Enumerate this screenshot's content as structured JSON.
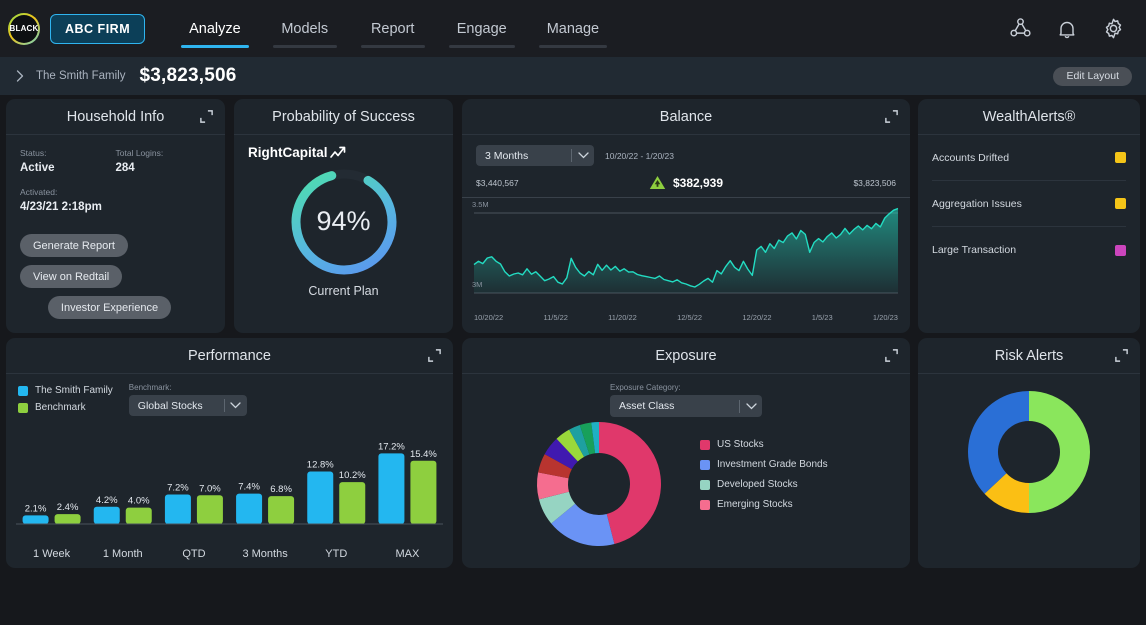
{
  "nav": {
    "logo_text": "BLACK",
    "firm_name": "ABC FIRM",
    "tabs": [
      {
        "label": "Analyze",
        "active": true
      },
      {
        "label": "Models",
        "active": false
      },
      {
        "label": "Report",
        "active": false
      },
      {
        "label": "Engage",
        "active": false
      },
      {
        "label": "Manage",
        "active": false
      }
    ],
    "icons": [
      "share-network-icon",
      "bell-icon",
      "gear-icon"
    ]
  },
  "clientbar": {
    "expand_icon": "chevron-right-icon",
    "client_name": "The Smith Family",
    "total_value": "$3,823,506",
    "edit_layout_label": "Edit Layout"
  },
  "household": {
    "title": "Household Info",
    "status_label": "Status:",
    "status_value": "Active",
    "logins_label": "Total Logins:",
    "logins_value": "284",
    "activated_label": "Activated:",
    "activated_value": "4/23/21 2:18pm",
    "btn_generate": "Generate Report",
    "btn_redtail": "View on Redtail",
    "btn_investor": "Investor Experience"
  },
  "probability": {
    "title": "Probability of Success",
    "brand": "RightCapital",
    "value": "94%",
    "caption": "Current Plan",
    "percent": 94,
    "gradient_start": "#4fd9b4",
    "gradient_end": "#5a97ee"
  },
  "balance": {
    "title": "Balance",
    "period_selected": "3 Months",
    "date_range": "10/20/22 - 1/20/23",
    "start_value": "$3,440,567",
    "change_value": "$382,939",
    "change_direction": "up",
    "end_value": "$3,823,506",
    "line_color": "#23dcc2",
    "chart_data": {
      "type": "area",
      "title": "Balance",
      "xlabel": "",
      "ylabel": "",
      "ylim": [
        3000000,
        3900000
      ],
      "ytick_labels": [
        "3.5M",
        "3M"
      ],
      "xtick_labels": [
        "10/20/22",
        "11/5/22",
        "11/20/22",
        "12/5/22",
        "12/20/22",
        "1/5/23",
        "1/20/23"
      ],
      "grid": false,
      "series": [
        {
          "name": "Balance",
          "values": [
            3448000,
            3470000,
            3455000,
            3492000,
            3500000,
            3470000,
            3452000,
            3400000,
            3372000,
            3385000,
            3392000,
            3380000,
            3420000,
            3384000,
            3400000,
            3370000,
            3340000,
            3352000,
            3368000,
            3330000,
            3318000,
            3360000,
            3490000,
            3430000,
            3392000,
            3372000,
            3402000,
            3380000,
            3450000,
            3410000,
            3444000,
            3412000,
            3436000,
            3404000,
            3420000,
            3398000,
            3400000,
            3382000,
            3374000,
            3368000,
            3362000,
            3356000,
            3372000,
            3348000,
            3340000,
            3332000,
            3346000,
            3326000,
            3318000,
            3306000,
            3298000,
            3316000,
            3338000,
            3356000,
            3330000,
            3408000,
            3386000,
            3436000,
            3474000,
            3430000,
            3408000,
            3470000,
            3418000,
            3376000,
            3546000,
            3570000,
            3530000,
            3588000,
            3556000,
            3612000,
            3596000,
            3640000,
            3660000,
            3620000,
            3676000,
            3650000,
            3530000,
            3596000,
            3622000,
            3600000,
            3636000,
            3660000,
            3626000,
            3650000,
            3690000,
            3652000,
            3682000,
            3706000,
            3680000,
            3710000,
            3688000,
            3724000,
            3700000,
            3760000,
            3788000,
            3812000,
            3823506
          ]
        }
      ]
    }
  },
  "wealth_alerts": {
    "title": "WealthAlerts®",
    "items": [
      {
        "label": "Accounts Drifted",
        "color": "#f5c518"
      },
      {
        "label": "Aggregation Issues",
        "color": "#f5c518"
      },
      {
        "label": "Large Transaction",
        "color": "#cc45bd"
      }
    ]
  },
  "performance": {
    "title": "Performance",
    "legend": [
      {
        "label": "The Smith Family",
        "color": "#23b7f0"
      },
      {
        "label": "Benchmark",
        "color": "#8ecf3f"
      }
    ],
    "benchmark_label": "Benchmark:",
    "benchmark_selected": "Global Stocks",
    "chart_data": {
      "type": "bar",
      "title": "Performance",
      "xlabel": "",
      "ylabel": "",
      "ylim": [
        0,
        19
      ],
      "grid": false,
      "categories": [
        "1 Week",
        "1 Month",
        "QTD",
        "3 Months",
        "YTD",
        "MAX"
      ],
      "series": [
        {
          "name": "The Smith Family",
          "color": "#23b7f0",
          "values": [
            2.1,
            4.2,
            7.2,
            7.4,
            12.8,
            17.2
          ],
          "labels": [
            "2.1%",
            "4.2%",
            "7.2%",
            "7.4%",
            "12.8%",
            "17.2%"
          ]
        },
        {
          "name": "Benchmark",
          "color": "#8ecf3f",
          "values": [
            2.4,
            4.0,
            7.0,
            6.8,
            10.2,
            15.4
          ],
          "labels": [
            "2.4%",
            "4.0%",
            "7.0%",
            "6.8%",
            "10.2%",
            "15.4%"
          ]
        }
      ]
    }
  },
  "exposure": {
    "title": "Exposure",
    "category_label": "Exposure Category:",
    "category_selected": "Asset Class",
    "legend": [
      {
        "label": "US Stocks",
        "color": "#e0386b"
      },
      {
        "label": "Investment Grade Bonds",
        "color": "#6a93f5"
      },
      {
        "label": "Developed Stocks",
        "color": "#96d4c2"
      },
      {
        "label": "Emerging Stocks",
        "color": "#f56d8f"
      }
    ],
    "chart_data": {
      "type": "pie",
      "title": "Exposure",
      "labels": [
        "US Stocks",
        "Investment Grade Bonds",
        "Developed Stocks",
        "Emerging Stocks",
        "Dark Red",
        "Indigo",
        "Yellow Green",
        "Teal",
        "Green",
        "Cyan"
      ],
      "values": [
        46,
        18,
        7,
        7,
        5,
        5,
        4,
        3,
        3,
        2
      ],
      "colors": [
        "#e0386b",
        "#6a93f5",
        "#96d4c2",
        "#f56d8f",
        "#b8342f",
        "#4019b0",
        "#9ad83a",
        "#1ea0a0",
        "#18a05a",
        "#1fb0c4"
      ]
    }
  },
  "risk_alerts": {
    "title": "Risk Alerts",
    "chart_data": {
      "type": "pie",
      "title": "Risk Alerts",
      "labels": [
        "Green",
        "Yellow",
        "Blue"
      ],
      "values": [
        50,
        13,
        37
      ],
      "colors": [
        "#8ae65c",
        "#fbbf14",
        "#2a6fd6"
      ]
    }
  }
}
